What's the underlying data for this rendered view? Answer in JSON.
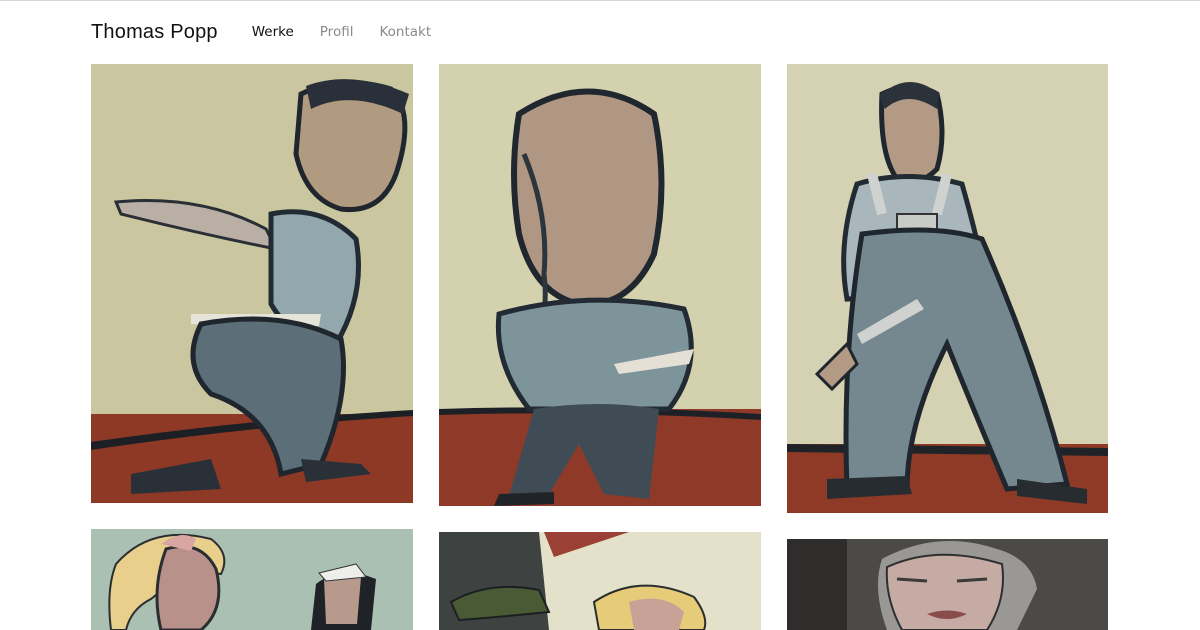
{
  "site": {
    "title": "Thomas Popp"
  },
  "nav": [
    {
      "label": "Werke",
      "active": true
    },
    {
      "label": "Profil",
      "active": false
    },
    {
      "label": "Kontakt",
      "active": false
    }
  ],
  "gallery": {
    "tiles": [
      {
        "subject": "painting of a man holding a knife and a stick"
      },
      {
        "subject": "painting of a seated bald man with a knife"
      },
      {
        "subject": "painting of a man in overalls holding a tool"
      },
      {
        "subject": "painting of two women, one in a nurse cap"
      },
      {
        "subject": "painting of a blonde woman and a figure in a cap"
      },
      {
        "subject": "painting of a grey-haired woman with closed eyes"
      }
    ]
  },
  "colors": {
    "wall": "#cfcca7",
    "floor": "#8f3a27",
    "figure_blue": "#6f8791",
    "outline": "#222a33",
    "skin": "#b99585",
    "nav_active": "#111111",
    "nav_inactive": "#8a8a8a"
  }
}
